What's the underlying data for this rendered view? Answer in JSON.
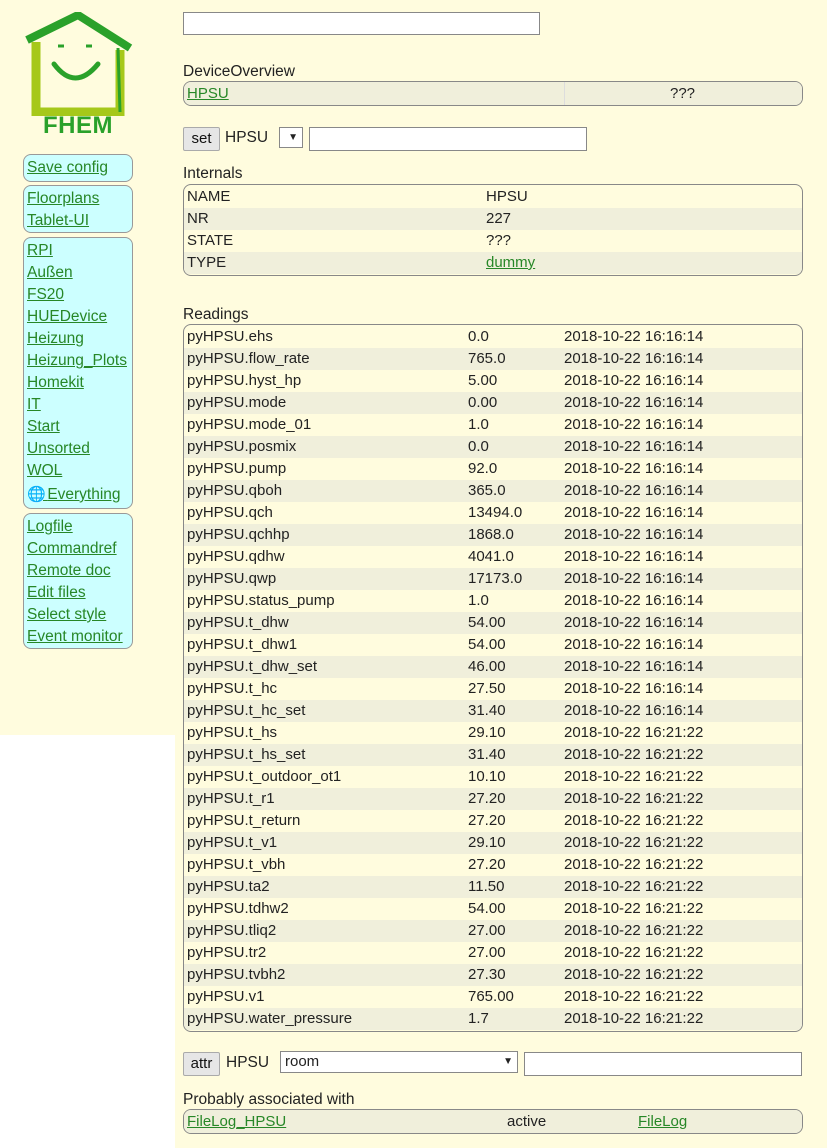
{
  "logo": {
    "text": "FHEM",
    "icon": "fhem-house-logo"
  },
  "menu": {
    "group1": [
      {
        "label": "Save config"
      }
    ],
    "group2": [
      {
        "label": "Floorplans"
      },
      {
        "label": "Tablet-UI"
      }
    ],
    "group3": [
      {
        "label": "RPI"
      },
      {
        "label": "Außen"
      },
      {
        "label": "FS20"
      },
      {
        "label": "HUEDevice"
      },
      {
        "label": "Heizung"
      },
      {
        "label": "Heizung_Plots"
      },
      {
        "label": "Homekit"
      },
      {
        "label": "IT"
      },
      {
        "label": "Start"
      },
      {
        "label": "Unsorted"
      },
      {
        "label": "WOL"
      },
      {
        "label": "Everything",
        "icon": "globe-icon"
      }
    ],
    "group4": [
      {
        "label": "Logfile"
      },
      {
        "label": "Commandref"
      },
      {
        "label": "Remote doc"
      },
      {
        "label": "Edit files"
      },
      {
        "label": "Select style"
      },
      {
        "label": "Event monitor"
      }
    ]
  },
  "search": {
    "value": ""
  },
  "device_overview": {
    "title": "DeviceOverview",
    "device": "HPSU",
    "state": "???"
  },
  "set_bar": {
    "button": "set",
    "device": "HPSU",
    "value": ""
  },
  "internals": {
    "title": "Internals",
    "rows": [
      {
        "name": "NAME",
        "value": "HPSU"
      },
      {
        "name": "NR",
        "value": "227"
      },
      {
        "name": "STATE",
        "value": "???"
      },
      {
        "name": "TYPE",
        "value": "dummy",
        "link": true
      }
    ]
  },
  "readings": {
    "title": "Readings",
    "rows": [
      {
        "name": "pyHPSU.ehs",
        "value": "0.0",
        "time": "2018-10-22 16:16:14"
      },
      {
        "name": "pyHPSU.flow_rate",
        "value": "765.0",
        "time": "2018-10-22 16:16:14"
      },
      {
        "name": "pyHPSU.hyst_hp",
        "value": "5.00",
        "time": "2018-10-22 16:16:14"
      },
      {
        "name": "pyHPSU.mode",
        "value": "0.00",
        "time": "2018-10-22 16:16:14"
      },
      {
        "name": "pyHPSU.mode_01",
        "value": "1.0",
        "time": "2018-10-22 16:16:14"
      },
      {
        "name": "pyHPSU.posmix",
        "value": "0.0",
        "time": "2018-10-22 16:16:14"
      },
      {
        "name": "pyHPSU.pump",
        "value": "92.0",
        "time": "2018-10-22 16:16:14"
      },
      {
        "name": "pyHPSU.qboh",
        "value": "365.0",
        "time": "2018-10-22 16:16:14"
      },
      {
        "name": "pyHPSU.qch",
        "value": "13494.0",
        "time": "2018-10-22 16:16:14"
      },
      {
        "name": "pyHPSU.qchhp",
        "value": "1868.0",
        "time": "2018-10-22 16:16:14"
      },
      {
        "name": "pyHPSU.qdhw",
        "value": "4041.0",
        "time": "2018-10-22 16:16:14"
      },
      {
        "name": "pyHPSU.qwp",
        "value": "17173.0",
        "time": "2018-10-22 16:16:14"
      },
      {
        "name": "pyHPSU.status_pump",
        "value": "1.0",
        "time": "2018-10-22 16:16:14"
      },
      {
        "name": "pyHPSU.t_dhw",
        "value": "54.00",
        "time": "2018-10-22 16:16:14"
      },
      {
        "name": "pyHPSU.t_dhw1",
        "value": "54.00",
        "time": "2018-10-22 16:16:14"
      },
      {
        "name": "pyHPSU.t_dhw_set",
        "value": "46.00",
        "time": "2018-10-22 16:16:14"
      },
      {
        "name": "pyHPSU.t_hc",
        "value": "27.50",
        "time": "2018-10-22 16:16:14"
      },
      {
        "name": "pyHPSU.t_hc_set",
        "value": "31.40",
        "time": "2018-10-22 16:16:14"
      },
      {
        "name": "pyHPSU.t_hs",
        "value": "29.10",
        "time": "2018-10-22 16:21:22"
      },
      {
        "name": "pyHPSU.t_hs_set",
        "value": "31.40",
        "time": "2018-10-22 16:21:22"
      },
      {
        "name": "pyHPSU.t_outdoor_ot1",
        "value": "10.10",
        "time": "2018-10-22 16:21:22"
      },
      {
        "name": "pyHPSU.t_r1",
        "value": "27.20",
        "time": "2018-10-22 16:21:22"
      },
      {
        "name": "pyHPSU.t_return",
        "value": "27.20",
        "time": "2018-10-22 16:21:22"
      },
      {
        "name": "pyHPSU.t_v1",
        "value": "29.10",
        "time": "2018-10-22 16:21:22"
      },
      {
        "name": "pyHPSU.t_vbh",
        "value": "27.20",
        "time": "2018-10-22 16:21:22"
      },
      {
        "name": "pyHPSU.ta2",
        "value": "11.50",
        "time": "2018-10-22 16:21:22"
      },
      {
        "name": "pyHPSU.tdhw2",
        "value": "54.00",
        "time": "2018-10-22 16:21:22"
      },
      {
        "name": "pyHPSU.tliq2",
        "value": "27.00",
        "time": "2018-10-22 16:21:22"
      },
      {
        "name": "pyHPSU.tr2",
        "value": "27.00",
        "time": "2018-10-22 16:21:22"
      },
      {
        "name": "pyHPSU.tvbh2",
        "value": "27.30",
        "time": "2018-10-22 16:21:22"
      },
      {
        "name": "pyHPSU.v1",
        "value": "765.00",
        "time": "2018-10-22 16:21:22"
      },
      {
        "name": "pyHPSU.water_pressure",
        "value": "1.7",
        "time": "2018-10-22 16:21:22"
      }
    ]
  },
  "attr_bar": {
    "button": "attr",
    "device": "HPSU",
    "selected": "room",
    "value": ""
  },
  "associated": {
    "title": "Probably associated with",
    "rows": [
      {
        "name": "FileLog_HPSU",
        "state": "active",
        "type": "FileLog"
      }
    ]
  },
  "colors": {
    "background": "#fffcde",
    "menu": "#ccffff",
    "link": "#278727",
    "logo": "#2aa12a"
  }
}
